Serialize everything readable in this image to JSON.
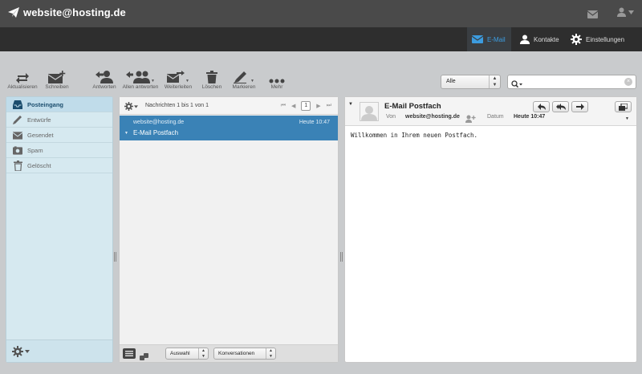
{
  "header": {
    "account": "website@hosting.de"
  },
  "nav": {
    "email": "E-Mail",
    "contacts": "Kontakte",
    "settings": "Einstellungen"
  },
  "toolbar": {
    "refresh": "Aktualisieren",
    "compose": "Schreiben",
    "reply": "Antworten",
    "reply_all": "Allen antworten",
    "forward": "Weiterleiten",
    "delete": "Löschen",
    "mark": "Markieren",
    "more": "Mehr"
  },
  "filter": {
    "selected": "Alle"
  },
  "search": {
    "value": "",
    "placeholder": ""
  },
  "folders": [
    {
      "label": "Posteingang",
      "icon": "inbox-icon"
    },
    {
      "label": "Entwürfe",
      "icon": "pencil-icon"
    },
    {
      "label": "Gesendet",
      "icon": "sent-icon"
    },
    {
      "label": "Spam",
      "icon": "spam-icon"
    },
    {
      "label": "Gelöscht",
      "icon": "trash-icon"
    }
  ],
  "list": {
    "count": "Nachrichten 1 bis 1 von 1",
    "page": "1",
    "select_label": "Auswahl",
    "threads_label": "Konversationen",
    "messages": [
      {
        "from": "website@hosting.de",
        "date": "Heute 10:47",
        "subject": "E-Mail Postfach"
      }
    ]
  },
  "preview": {
    "subject": "E-Mail Postfach",
    "from_label": "Von",
    "from": "website@hosting.de",
    "date_label": "Datum",
    "date": "Heute 10:47",
    "body": "Willkommen in Ihrem neuen Postfach."
  },
  "colors": {
    "accent": "#3a82b6",
    "nav_active": "#3c9ce0",
    "header_bg": "#4a4a4a",
    "nav_bg": "#2e2e2e"
  }
}
